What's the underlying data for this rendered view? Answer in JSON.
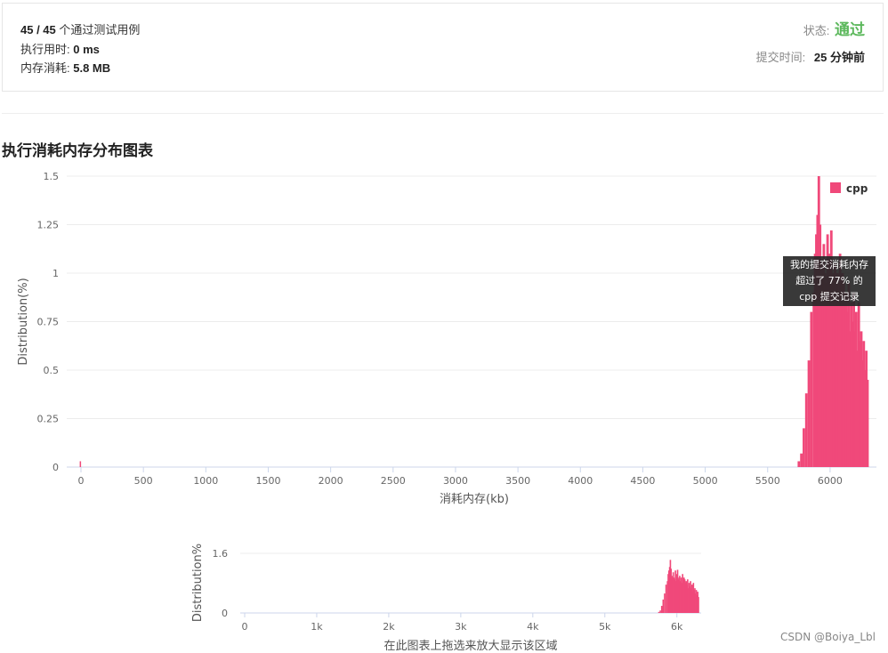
{
  "summary": {
    "cases_passed": "45 / 45",
    "cases_suffix": "个通过测试用例",
    "runtime_label": "执行用时:",
    "runtime_value": "0 ms",
    "memory_label": "内存消耗:",
    "memory_value": "5.8 MB",
    "status_label": "状态:",
    "status_value": "通过",
    "submit_label": "提交时间:",
    "submit_value": "25 分钟前"
  },
  "colors": {
    "accent": "#f0497a",
    "status": "#5cb85c"
  },
  "section_title": "执行消耗内存分布图表",
  "tooltip": {
    "line1": "我的提交消耗内存",
    "line2": "超过了 77% 的",
    "line3": "cpp 提交记录"
  },
  "navigator": {
    "hint": "在此图表上拖选来放大显示该区域"
  },
  "watermark": "CSDN @Boiya_Lbl",
  "chart_data": [
    {
      "type": "bar",
      "title": "",
      "xlabel": "消耗内存(kb)",
      "ylabel": "Distribution(%)",
      "xlim": [
        0,
        6300
      ],
      "ylim": [
        0,
        1.5
      ],
      "x_ticks": [
        "0",
        "500",
        "1000",
        "1500",
        "2000",
        "2500",
        "3000",
        "3500",
        "4000",
        "4500",
        "5000",
        "5500",
        "6000"
      ],
      "y_ticks": [
        "0",
        "0.25",
        "0.5",
        "0.75",
        "1",
        "1.25",
        "1.5"
      ],
      "legend": "top-right",
      "series": [
        {
          "name": "cpp",
          "x": [
            0,
            5750,
            5770,
            5790,
            5810,
            5830,
            5850,
            5870,
            5880,
            5890,
            5900,
            5910,
            5920,
            5930,
            5940,
            5950,
            5960,
            5970,
            5980,
            5990,
            6000,
            6010,
            6020,
            6030,
            6040,
            6050,
            6060,
            6070,
            6080,
            6090,
            6100,
            6110,
            6120,
            6130,
            6140,
            6150,
            6160,
            6170,
            6180,
            6190,
            6200,
            6210,
            6220,
            6230,
            6240,
            6250,
            6260,
            6270,
            6280,
            6290,
            6300
          ],
          "values": [
            0.03,
            0.03,
            0.07,
            0.2,
            0.38,
            0.55,
            0.8,
            0.9,
            1.1,
            1.2,
            1.3,
            1.5,
            1.25,
            1.05,
            1.0,
            1.15,
            1.0,
            0.95,
            1.2,
            0.9,
            1.1,
            1.22,
            0.95,
            1.0,
            1.05,
            0.9,
            1.0,
            0.85,
            1.1,
            0.92,
            1.0,
            0.95,
            0.85,
            0.9,
            0.8,
            0.95,
            0.7,
            0.85,
            0.75,
            0.9,
            0.7,
            0.8,
            0.6,
            0.85,
            0.65,
            0.7,
            0.55,
            0.65,
            0.5,
            0.6,
            0.45
          ]
        }
      ]
    },
    {
      "type": "bar",
      "title": "",
      "xlabel": "",
      "ylabel": "Distribution%",
      "xlim": [
        0,
        6300
      ],
      "ylim": [
        0,
        1.6
      ],
      "x_ticks": [
        "0",
        "1k",
        "2k",
        "3k",
        "4k",
        "5k",
        "6k"
      ],
      "y_ticks": [
        "0",
        "1.6"
      ]
    }
  ]
}
